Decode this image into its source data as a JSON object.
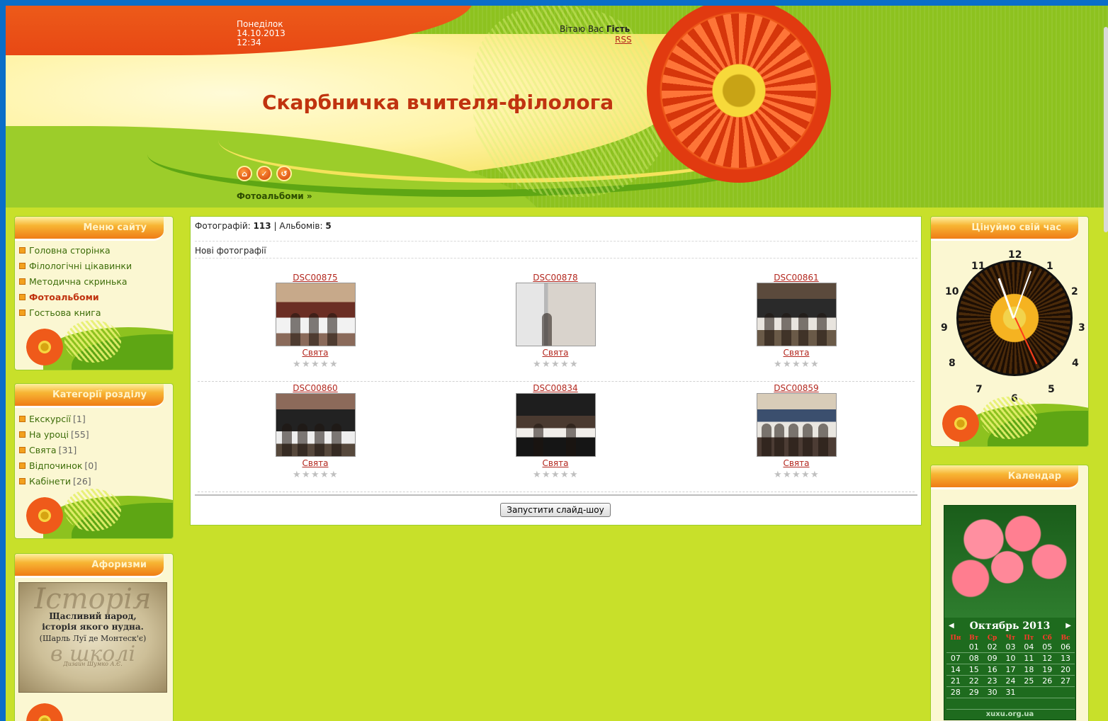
{
  "header": {
    "weekday": "Понеділок",
    "date": "14.10.2013",
    "time": "12:34",
    "welcome_prefix": "Вітаю Вас",
    "welcome_user": "Гість",
    "rss": "RSS",
    "site_title": "Скарбничка вчителя-філолога",
    "breadcrumb": "Фотоальбоми »",
    "icons": [
      "home-icon",
      "check-icon",
      "login-icon"
    ]
  },
  "site_menu": {
    "title": "Меню сайту",
    "items": [
      {
        "label": "Головна сторінка"
      },
      {
        "label": "Філологічні цікавинки"
      },
      {
        "label": "Методична скринька"
      },
      {
        "label": "Фотоальбоми",
        "active": true
      },
      {
        "label": "Гостьова книга"
      }
    ]
  },
  "categories": {
    "title": "Категорії розділу",
    "items": [
      {
        "label": "Екскурсії",
        "count": "[1]"
      },
      {
        "label": "На уроці",
        "count": "[55]"
      },
      {
        "label": "Свята",
        "count": "[31]"
      },
      {
        "label": "Відпочинок",
        "count": "[0]"
      },
      {
        "label": "Кабінети",
        "count": "[26]"
      }
    ]
  },
  "aphorisms": {
    "title": "Афоризми",
    "img_title": "Історія",
    "text_line1": "Щасливий народ,",
    "text_line2": "історія якого нудна.",
    "author": "(Шарль Луї де Монтеск'є)",
    "img_footer": "в школі",
    "img_sign": "Дизайн Шумко А.Є."
  },
  "main": {
    "photos_label": "Фотографій:",
    "photos_count": "113",
    "separator": "|",
    "albums_label": "Альбомів:",
    "albums_count": "5",
    "new_photos": "Нові фотографії",
    "photos": [
      {
        "name": "DSC00875",
        "category": "Свята"
      },
      {
        "name": "DSC00878",
        "category": "Свята"
      },
      {
        "name": "DSC00861",
        "category": "Свята"
      },
      {
        "name": "DSC00860",
        "category": "Свята"
      },
      {
        "name": "DSC00834",
        "category": "Свята"
      },
      {
        "name": "DSC00859",
        "category": "Свята"
      }
    ],
    "slideshow_button": "Запустити слайд-шоу"
  },
  "clock_block": {
    "title": "Цінуймо свій час",
    "numbers": [
      "12",
      "1",
      "2",
      "3",
      "4",
      "5",
      "6",
      "7",
      "8",
      "9",
      "10",
      "11"
    ]
  },
  "calendar_block": {
    "title": "Календар",
    "month": "Октябрь 2013",
    "weekdays": [
      "Пн",
      "Вт",
      "Ср",
      "Чт",
      "Пт",
      "Сб",
      "Вс"
    ],
    "days": [
      "",
      "01",
      "02",
      "03",
      "04",
      "05",
      "06",
      "07",
      "08",
      "09",
      "10",
      "11",
      "12",
      "13",
      "14",
      "15",
      "16",
      "17",
      "18",
      "19",
      "20",
      "21",
      "22",
      "23",
      "24",
      "25",
      "26",
      "27",
      "28",
      "29",
      "30",
      "31",
      "",
      "",
      "",
      "",
      "",
      "",
      "",
      "",
      "",
      ""
    ],
    "site": "xuxu.org.ua"
  },
  "colors": {
    "background": "#c8e02a",
    "accent_red": "#c0330f",
    "link": "#b3271e",
    "block_head": "#ef7c16"
  }
}
